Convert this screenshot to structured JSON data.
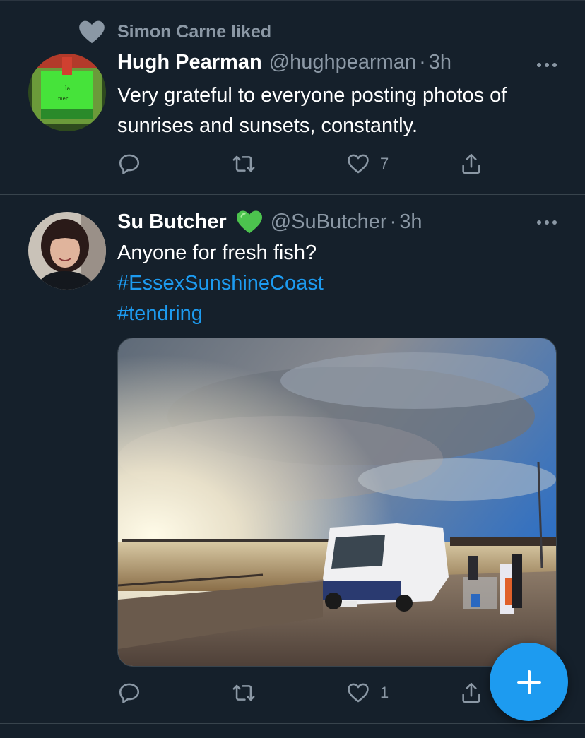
{
  "feed": {
    "tweets": [
      {
        "social_context": "Simon Carne liked",
        "display_name": "Hugh Pearman",
        "handle": "@hughpearman",
        "separator": "·",
        "time": "3h",
        "text": "Very grateful to everyone posting photos of sunrises and sunsets, constantly.",
        "hashtags": [],
        "actions": {
          "reply_count": "",
          "retweet_count": "",
          "like_count": "7"
        }
      },
      {
        "display_name": "Su Butcher",
        "name_emoji": "green-heart-icon",
        "handle": "@SuButcher",
        "separator": "·",
        "time": "3h",
        "text": "Anyone for fresh fish?",
        "hashtags": [
          "#EssexSunshineCoast",
          "#tendring"
        ],
        "media": {
          "type": "photo"
        },
        "actions": {
          "reply_count": "",
          "retweet_count": "",
          "like_count": "1"
        }
      }
    ]
  },
  "compose_button": {
    "icon": "plus-icon"
  },
  "colors": {
    "background": "#15202b",
    "accent": "#1d9bf0",
    "secondary_text": "#8b98a5",
    "divider": "#38444d",
    "verified_heart": "#4cc34e"
  }
}
